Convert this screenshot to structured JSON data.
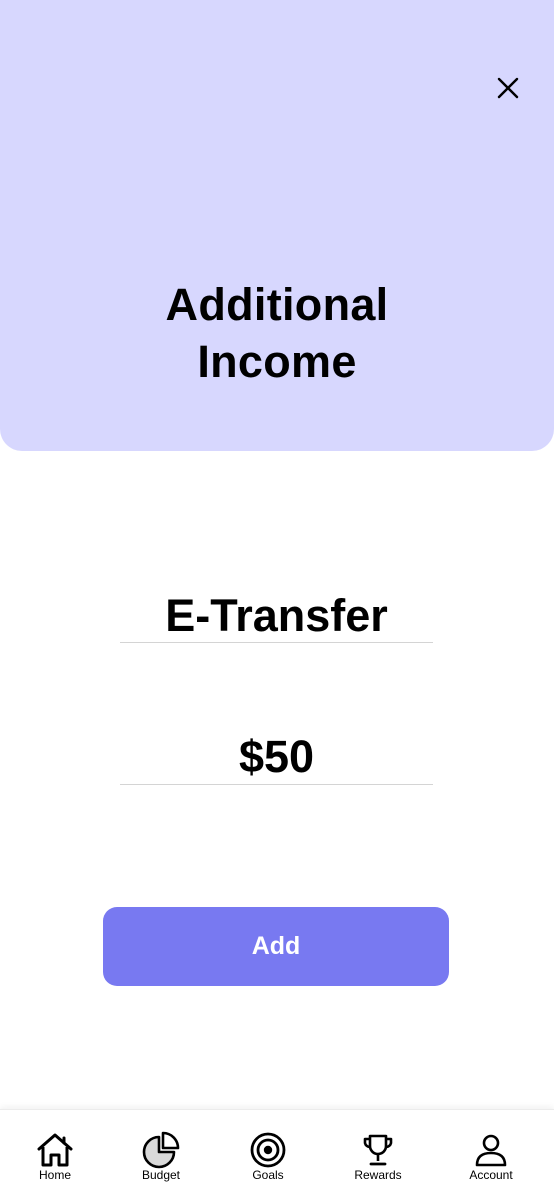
{
  "header": {
    "title_line1": "Additional",
    "title_line2": "Income",
    "close_icon": "close-icon",
    "background_color": "#d7d7fe"
  },
  "form": {
    "source_value": "E-Transfer",
    "amount_value": "$50"
  },
  "actions": {
    "add_label": "Add",
    "accent_color": "#7879f1"
  },
  "tabbar": {
    "items": [
      {
        "label": "Home",
        "icon": "home-icon"
      },
      {
        "label": "Budget",
        "icon": "pie-chart-icon"
      },
      {
        "label": "Goals",
        "icon": "target-icon"
      },
      {
        "label": "Rewards",
        "icon": "trophy-icon"
      },
      {
        "label": "Account",
        "icon": "user-icon"
      }
    ]
  }
}
